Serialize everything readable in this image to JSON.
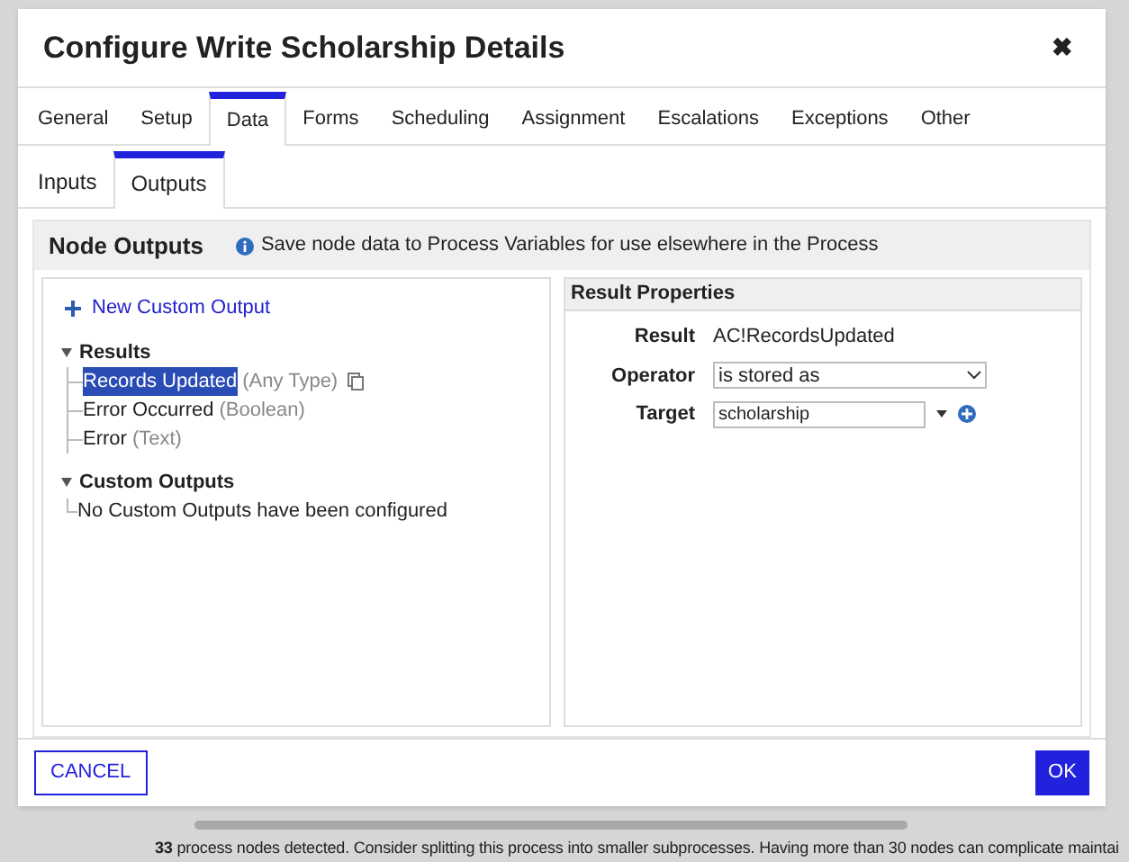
{
  "dialog": {
    "title": "Configure Write Scholarship Details",
    "close": "✖"
  },
  "tabs": [
    {
      "label": "General",
      "selected": false
    },
    {
      "label": "Setup",
      "selected": false
    },
    {
      "label": "Data",
      "selected": true
    },
    {
      "label": "Forms",
      "selected": false
    },
    {
      "label": "Scheduling",
      "selected": false
    },
    {
      "label": "Assignment",
      "selected": false
    },
    {
      "label": "Escalations",
      "selected": false
    },
    {
      "label": "Exceptions",
      "selected": false
    },
    {
      "label": "Other",
      "selected": false
    }
  ],
  "subtabs": [
    {
      "label": "Inputs",
      "selected": false
    },
    {
      "label": "Outputs",
      "selected": true
    }
  ],
  "section": {
    "title": "Node Outputs",
    "info": "Save node data to Process Variables for use elsewhere in the Process"
  },
  "outputs_tree": {
    "new_button": "New Custom Output",
    "groups": [
      {
        "label": "Results",
        "expanded": true,
        "children": [
          {
            "label": "Records Updated",
            "type": "(Any Type)",
            "selected": true,
            "copy": true
          },
          {
            "label": "Error Occurred",
            "type": "(Boolean)",
            "selected": false,
            "copy": false
          },
          {
            "label": "Error",
            "type": "(Text)",
            "selected": false,
            "copy": false
          }
        ]
      },
      {
        "label": "Custom Outputs",
        "expanded": true,
        "empty_text": "No Custom Outputs have been configured"
      }
    ]
  },
  "result_properties": {
    "title": "Result Properties",
    "result_label": "Result",
    "result_value": "AC!RecordsUpdated",
    "operator_label": "Operator",
    "operator_value": "is stored as",
    "target_label": "Target",
    "target_value": "scholarship"
  },
  "buttons": {
    "cancel": "CANCEL",
    "ok": "OK"
  },
  "status_bar": {
    "text": "**33** process nodes detected. Consider splitting this process into smaller subprocesses. Having more than 30 nodes can complicate maintai"
  }
}
